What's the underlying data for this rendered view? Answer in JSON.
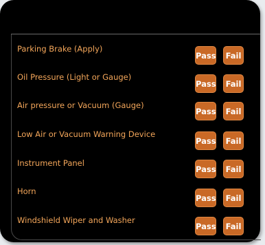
{
  "checklist": {
    "items": [
      {
        "label": "Parking Brake (Apply)",
        "pass_label": "Pass",
        "fail_label": "Fail"
      },
      {
        "label": "Oil Pressure (Light or Gauge)",
        "pass_label": "Pass",
        "fail_label": "Fail"
      },
      {
        "label": "Air pressure or Vacuum (Gauge)",
        "pass_label": "Pass",
        "fail_label": "Fail"
      },
      {
        "label": "Low Air or Vacuum Warning Device",
        "pass_label": "Pass",
        "fail_label": "Fail"
      },
      {
        "label": "Instrument Panel",
        "pass_label": "Pass",
        "fail_label": "Fail"
      },
      {
        "label": "Horn",
        "pass_label": "Pass",
        "fail_label": "Fail"
      },
      {
        "label": "Windshield Wiper and Washer",
        "pass_label": "Pass",
        "fail_label": "Fail"
      }
    ]
  },
  "colors": {
    "background": "#000000",
    "label_text": "#f3a65a",
    "button_fill": "#c96926",
    "button_text": "#ffffff"
  }
}
